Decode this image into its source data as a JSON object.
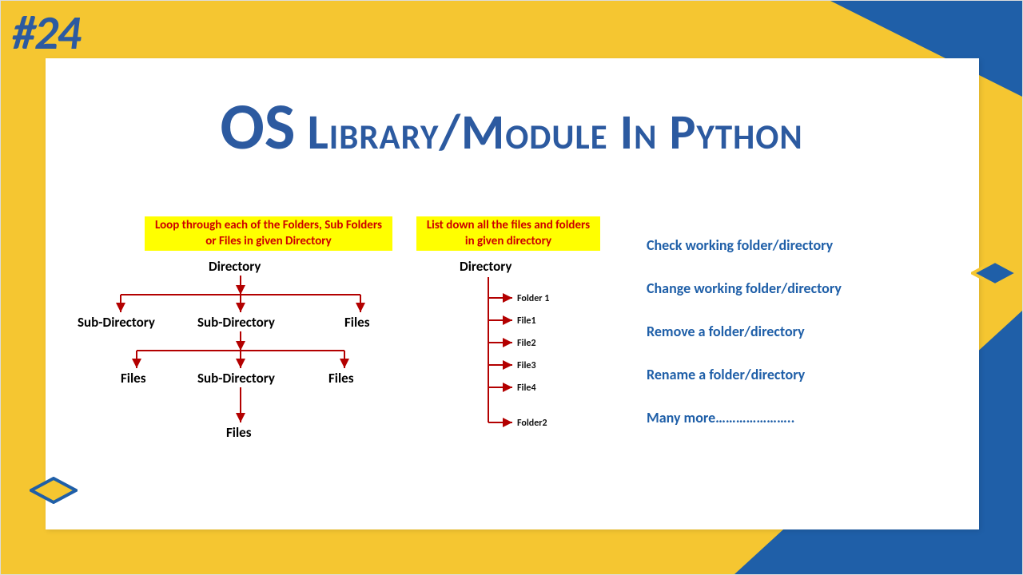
{
  "badge": "#24",
  "title": {
    "os": "OS",
    "rest": " Library/Module In Python"
  },
  "caption_left": "Loop through each of the Folders, Sub Folders or Files in given Directory",
  "caption_right": "List down all the files and folders in given directory",
  "features": [
    "Check working folder/directory",
    "Change working folder/directory",
    "Remove a folder/directory",
    "Rename a folder/directory",
    "Many more………………….."
  ],
  "tree1": {
    "root": "Directory",
    "level1": [
      "Sub-Directory",
      "Sub-Directory",
      "Files"
    ],
    "level2": [
      "Files",
      "Sub-Directory",
      "Files"
    ],
    "level3": "Files"
  },
  "tree2": {
    "root": "Directory",
    "items": [
      "Folder 1",
      "File1",
      "File2",
      "File3",
      "File4",
      "Folder2"
    ]
  },
  "colors": {
    "accent": "#1f5fa8",
    "highlight": "#ffff00",
    "danger": "#cc0000",
    "arrow": "#b30000"
  }
}
